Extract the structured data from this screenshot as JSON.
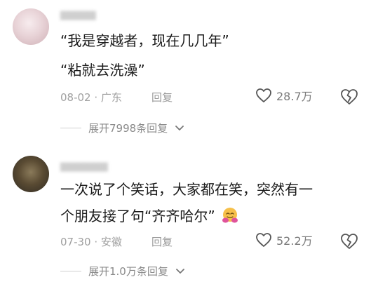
{
  "comments": [
    {
      "lines": [
        "“我是穿越者，现在几几年”",
        "“粘就去洗澡”"
      ],
      "date_location": "08-02 · 广东",
      "reply_label": "回复",
      "likes": "28.7万",
      "expand_label": "展开7998条回复"
    },
    {
      "lines": [
        "一次说了个笑话，大家都在笑，突然有一",
        "个朋友接了句“齐齐哈尔”"
      ],
      "date_location": "07-30 · 安徽",
      "reply_label": "回复",
      "likes": "52.2万",
      "expand_label": "展开1.0万条回复"
    }
  ],
  "icons": {
    "like": "heart-outline-icon",
    "dislike": "broken-heart-icon",
    "expand": "chevron-down-icon",
    "emoji": "hug-emoji"
  }
}
